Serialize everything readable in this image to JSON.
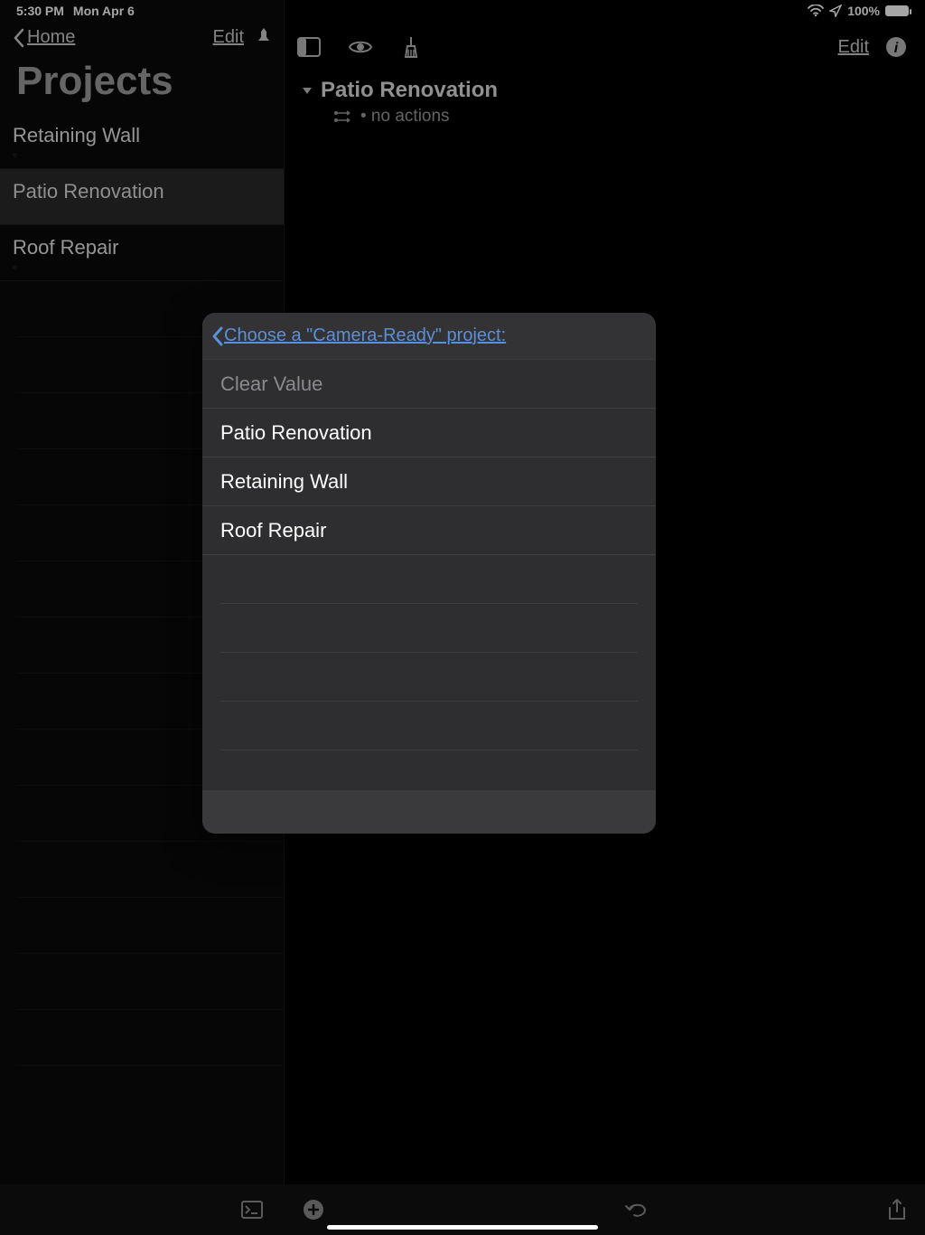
{
  "status": {
    "time": "5:30 PM",
    "date": "Mon Apr 6",
    "battery": "100%"
  },
  "sidebar": {
    "back_label": "Home",
    "edit_label": "Edit",
    "title": "Projects",
    "items": [
      {
        "title": "Retaining Wall",
        "selected": false
      },
      {
        "title": "Patio Renovation",
        "selected": true
      },
      {
        "title": "Roof Repair",
        "selected": false
      }
    ]
  },
  "main": {
    "edit_label": "Edit",
    "project_title": "Patio Renovation",
    "project_sub": "• no actions"
  },
  "popover": {
    "back_label": "Choose a \"Camera-Ready\" project:",
    "clear_label": "Clear Value",
    "options": [
      "Patio Renovation",
      "Retaining Wall",
      "Roof Repair"
    ]
  }
}
